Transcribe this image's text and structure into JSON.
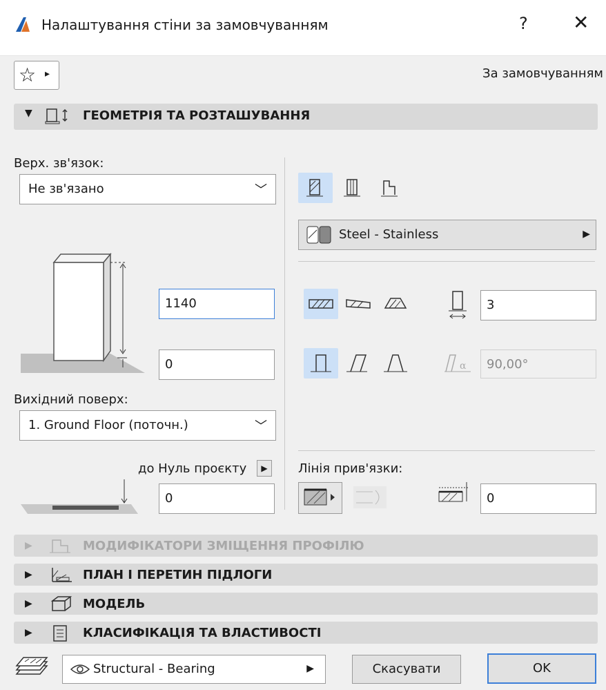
{
  "window": {
    "title": "Налаштування стіни за замовчуванням",
    "help": "?",
    "close": "✕"
  },
  "favorites": {
    "star": "☆",
    "arrow": "▸"
  },
  "default_label": "За замовчуванням",
  "geometry": {
    "header": "ГЕОМЕТРІЯ ТА РОЗТАШУВАННЯ",
    "top_link_label": "Верх. зв'язок:",
    "top_link_value": "Не зв'язано",
    "height_value": "1140",
    "offset_value": "0",
    "home_story_label": "Вихідний поверх:",
    "home_story_value": "1. Ground Floor (поточн.)",
    "to_project_zero_label": "до Нуль проєкту",
    "base_offset_value": "0",
    "material": "Steel - Stainless",
    "thickness_value": "3",
    "angle_value": "90,00°",
    "ref_line_label": "Лінія прив'язки:",
    "ref_offset_value": "0"
  },
  "sections": [
    {
      "label": "МОДИФІКАТОРИ ЗМІЩЕННЯ ПРОФІЛЮ",
      "enabled": false
    },
    {
      "label": "ПЛАН І ПЕРЕТИН ПІДЛОГИ",
      "enabled": true
    },
    {
      "label": "МОДЕЛЬ",
      "enabled": true
    },
    {
      "label": "КЛАСИФІКАЦІЯ ТА ВЛАСТИВОСТІ",
      "enabled": true
    }
  ],
  "footer": {
    "layer_value": "Structural - Bearing",
    "cancel": "Скасувати",
    "ok": "OK"
  },
  "colors": {
    "accent": "#3c7fd8",
    "selected_bg": "#cce0f7",
    "header_bg": "#d9d9d9"
  }
}
